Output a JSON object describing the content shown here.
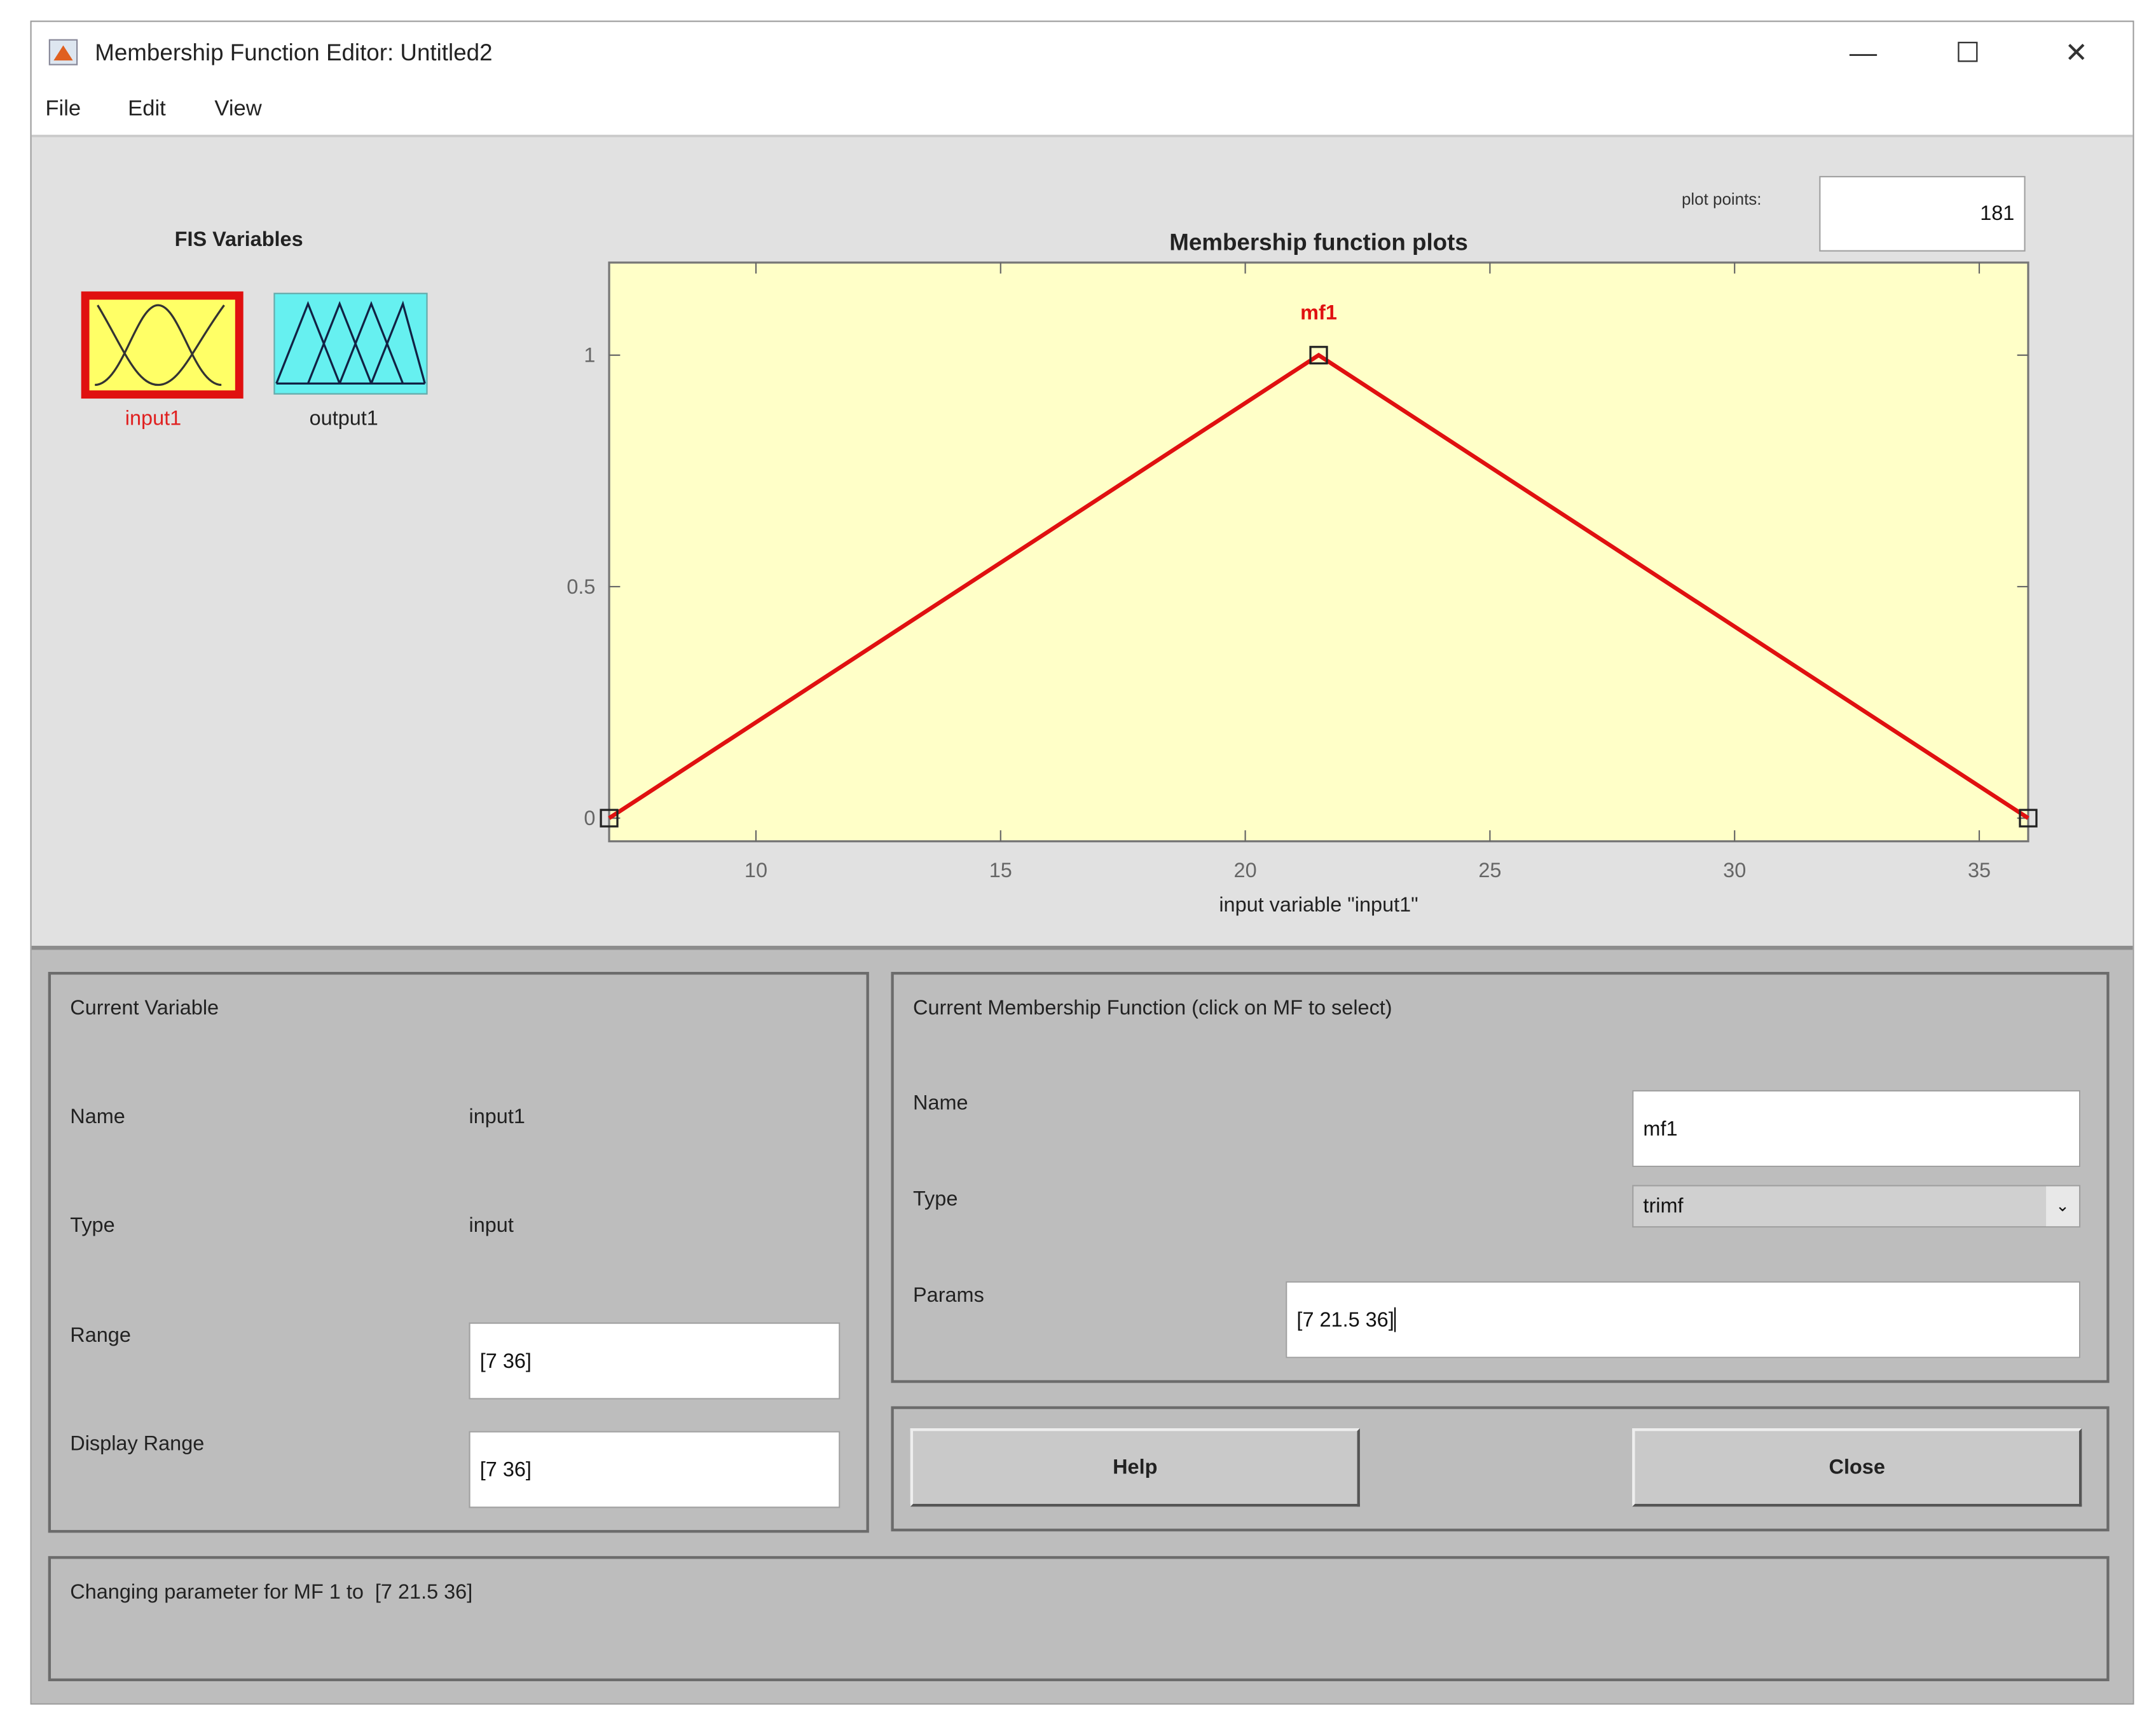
{
  "window": {
    "title": "Membership Function Editor: Untitled2",
    "controls": [
      "minimize-icon",
      "maximize-icon",
      "close-icon"
    ]
  },
  "menu": {
    "file": "File",
    "edit": "Edit",
    "view": "View"
  },
  "fis_variables": {
    "title": "FIS Variables",
    "items": [
      {
        "label": "input1",
        "selected": true,
        "color": "#ffff66",
        "label_color": "#e02020"
      },
      {
        "label": "output1",
        "selected": false,
        "color": "#66ffff",
        "label_color": "#222222"
      }
    ]
  },
  "plot_points": {
    "label": "plot points:",
    "value": "181"
  },
  "chart_data": {
    "type": "line",
    "title": "Membership function plots",
    "xlabel": "input variable \"input1\"",
    "ylabel": "",
    "xlim": [
      7,
      36
    ],
    "ylim": [
      -0.05,
      1.2
    ],
    "xticks": [
      10,
      15,
      20,
      25,
      30,
      35
    ],
    "yticks": [
      0,
      0.5,
      1
    ],
    "ytick_labels": [
      "0",
      "0.5",
      "1"
    ],
    "grid": false,
    "background": "#ffffc8",
    "series": [
      {
        "name": "mf1",
        "color": "#e01010",
        "x": [
          7,
          21.5,
          36
        ],
        "y": [
          0,
          1,
          0
        ]
      }
    ]
  },
  "current_variable": {
    "title": "Current Variable",
    "name_label": "Name",
    "name_value": "input1",
    "type_label": "Type",
    "type_value": "input",
    "range_label": "Range",
    "range_value": "[7 36]",
    "display_range_label": "Display Range",
    "display_range_value": "[7 36]"
  },
  "current_mf": {
    "title": "Current Membership Function (click on MF to select)",
    "name_label": "Name",
    "name_value": "mf1",
    "type_label": "Type",
    "type_value": "trimf",
    "params_label": "Params",
    "params_value": "[7 21.5 36]"
  },
  "buttons": {
    "help": "Help",
    "close": "Close"
  },
  "status": "Changing parameter for MF 1 to  [7 21.5 36]"
}
